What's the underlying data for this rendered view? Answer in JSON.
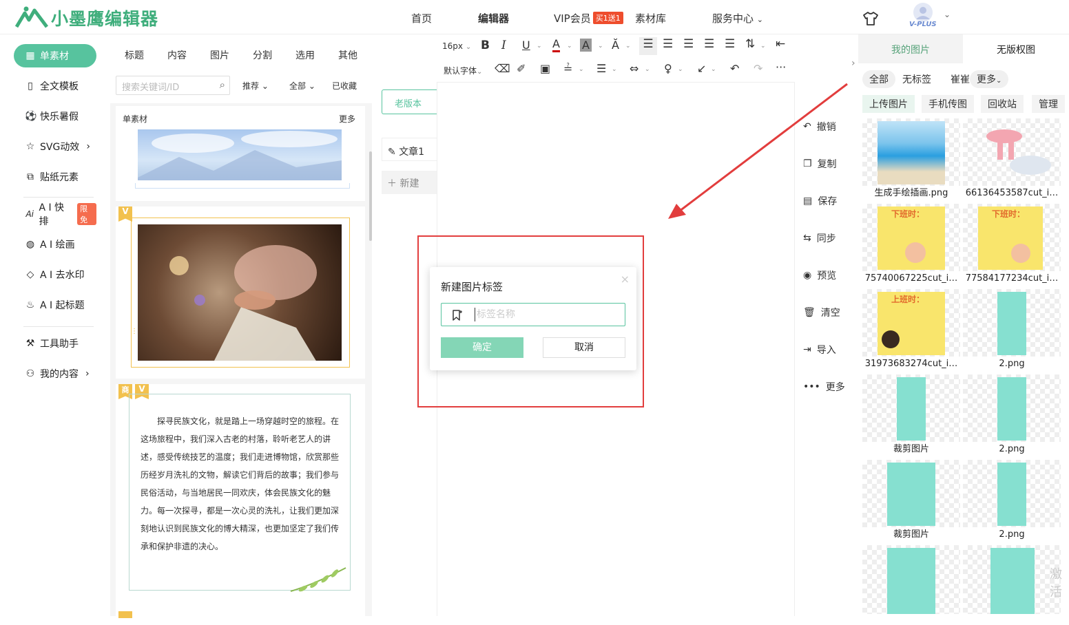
{
  "header": {
    "logo_text": "小墨鹰编辑器",
    "nav": [
      "首页",
      "编辑器",
      "VIP会员",
      "素材库",
      "服务中心"
    ],
    "vip_badge": "买1送1",
    "vplus": "V-PLUS"
  },
  "leftnav": {
    "items": [
      {
        "label": "单素材",
        "icon": "grid-icon"
      },
      {
        "label": "全文模板",
        "icon": "template-icon"
      },
      {
        "label": "快乐暑假",
        "icon": "ball-icon"
      },
      {
        "label": "SVG动效",
        "icon": "star-icon"
      },
      {
        "label": "贴纸元素",
        "icon": "puzzle-icon"
      },
      {
        "label": "A I 快排",
        "icon": "ai-icon"
      },
      {
        "label": "A I 绘画",
        "icon": "palette-icon"
      },
      {
        "label": "A I 去水印",
        "icon": "drop-icon"
      },
      {
        "label": "A I 起标题",
        "icon": "flame-icon"
      },
      {
        "label": "工具助手",
        "icon": "tool-icon"
      },
      {
        "label": "我的内容",
        "icon": "user-icon"
      }
    ],
    "limit_badge": "限免"
  },
  "materials": {
    "tabs": [
      "标题",
      "内容",
      "图片",
      "分割",
      "选用",
      "其他"
    ],
    "search_placeholder": "搜索关键词/ID",
    "filter_recommend": "推荐",
    "filter_all": "全部",
    "collected": "已收藏",
    "section_title": "单素材",
    "more": "更多",
    "badge_v": "V",
    "badge_shang": "商",
    "article_text": "探寻民族文化，就是踏上一场穿越时空的旅程。在这场旅程中，我们深入古老的村落，聆听老艺人的讲述，感受传统技艺的温度；我们走进博物馆，欣赏那些历经岁月洗礼的文物，解读它们背后的故事；我们参与民俗活动，与当地居民一同欢庆，体会民族文化的魅力。每一次探寻，都是一次心灵的洗礼，让我们更加深刻地认识到民族文化的博大精深，也更加坚定了我们传承和保护非遗的决心。"
  },
  "middle": {
    "old_version": "老版本",
    "article": "文章1",
    "new": "新建"
  },
  "toolbar": {
    "font_size": "16px",
    "font_family": "默认字体"
  },
  "actions": [
    "撤销",
    "复制",
    "保存",
    "同步",
    "预览",
    "清空",
    "导入",
    "更多"
  ],
  "rpanel": {
    "tabs": [
      "我的图片",
      "无版权图"
    ],
    "filters": [
      "全部",
      "无标签",
      "崔崔",
      "更多"
    ],
    "buttons": [
      "上传图片",
      "手机传图",
      "回收站",
      "管理"
    ],
    "images": [
      {
        "caption": "生成手绘插画.png"
      },
      {
        "caption": "66136453587cut_i…"
      },
      {
        "caption": "75740067225cut_i…"
      },
      {
        "caption": "77584177234cut_i…"
      },
      {
        "caption": "31973683274cut_i…"
      },
      {
        "caption": "2.png"
      },
      {
        "caption": "裁剪图片"
      },
      {
        "caption": "2.png"
      },
      {
        "caption": "裁剪图片"
      },
      {
        "caption": "2.png"
      },
      {
        "caption": ""
      },
      {
        "caption": ""
      }
    ],
    "poster_title_off": "下班时：",
    "poster_title_on": "上班时：",
    "watermark": "激活"
  },
  "dialog": {
    "title": "新建图片标签",
    "close": "×",
    "placeholder": "标签名称",
    "value": "",
    "ok": "确定",
    "cancel": "取消"
  }
}
